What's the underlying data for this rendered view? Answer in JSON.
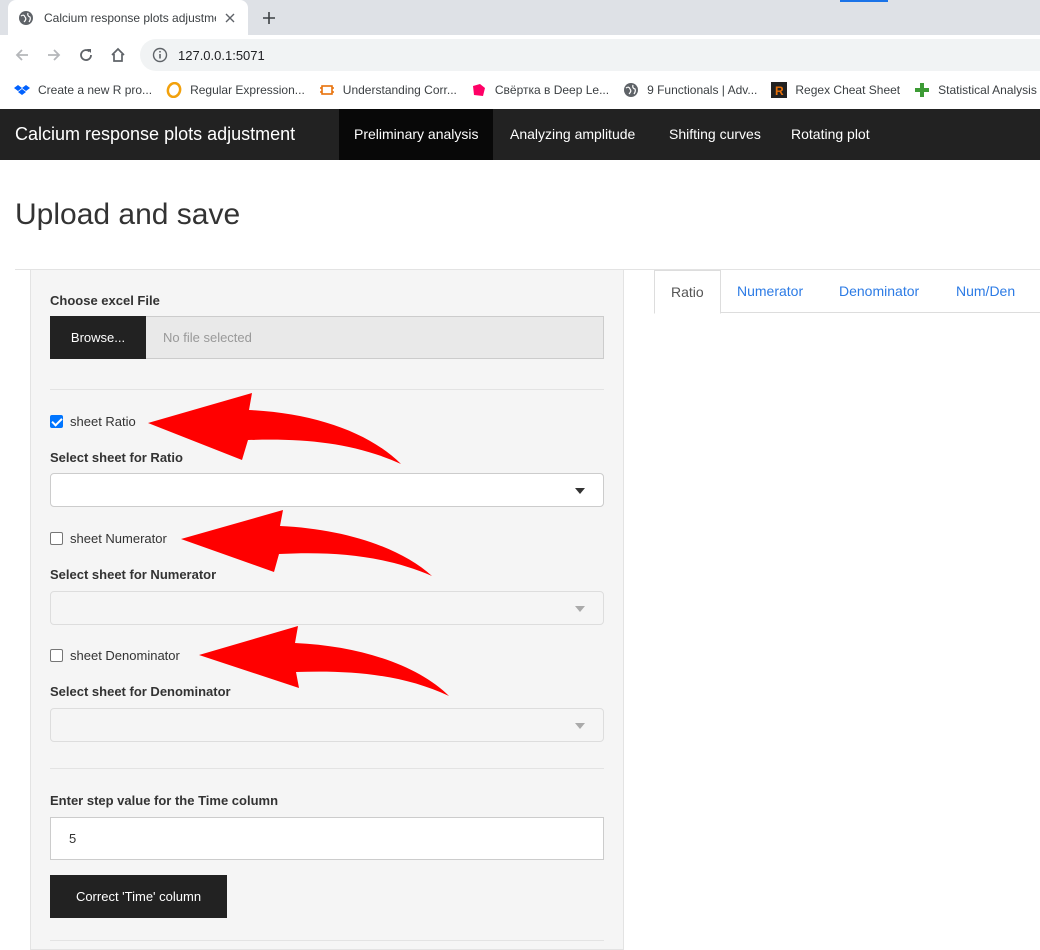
{
  "browser": {
    "tab_title": "Calcium response plots adjustme",
    "url": "127.0.0.1:5071",
    "bookmarks": [
      {
        "label": "Create a new R pro...",
        "icon": "dropbox-icon",
        "color": "#0061fe"
      },
      {
        "label": "Regular Expression...",
        "icon": "regex-icon",
        "color": "#f2a10c"
      },
      {
        "label": "Understanding Corr...",
        "icon": "chip-icon",
        "color": "#e8710a"
      },
      {
        "label": "Свёртка в Deep Le...",
        "icon": "habr-icon",
        "color": "#ff0066"
      },
      {
        "label": "9 Functionals | Adv...",
        "icon": "globe-icon",
        "color": "#5f6368"
      },
      {
        "label": "Regex Cheat Sheet",
        "icon": "r-logo-icon",
        "color": "#e8710a"
      },
      {
        "label": "Statistical Analysis -...",
        "icon": "cross-icon",
        "color": "#3d9b35"
      }
    ]
  },
  "navbar": {
    "brand": "Calcium response plots adjustment",
    "items": [
      "Preliminary analysis",
      "Analyzing amplitude",
      "Shifting curves",
      "Rotating plot"
    ],
    "active_index": 0
  },
  "page": {
    "title": "Upload and save"
  },
  "sidebar": {
    "file_label": "Choose excel File",
    "browse_label": "Browse...",
    "file_placeholder": "No file selected",
    "ratio_checkbox": "sheet Ratio",
    "ratio_checked": true,
    "ratio_select_label": "Select sheet for Ratio",
    "numerator_checkbox": "sheet Numerator",
    "numerator_checked": false,
    "numerator_select_label": "Select sheet for Numerator",
    "denominator_checkbox": "sheet Denominator",
    "denominator_checked": false,
    "denominator_select_label": "Select sheet for Denominator",
    "step_label": "Enter step value for the Time column",
    "step_value": "5",
    "correct_button": "Correct 'Time' column"
  },
  "main_tabs": [
    "Ratio",
    "Numerator",
    "Denominator",
    "Num/Den"
  ],
  "colors": {
    "navbar_bg": "#222222",
    "active_nav_bg": "#080808",
    "link": "#2c7be5",
    "annotation_arrow": "#ff0000",
    "checkbox_checked": "#0075ff"
  }
}
